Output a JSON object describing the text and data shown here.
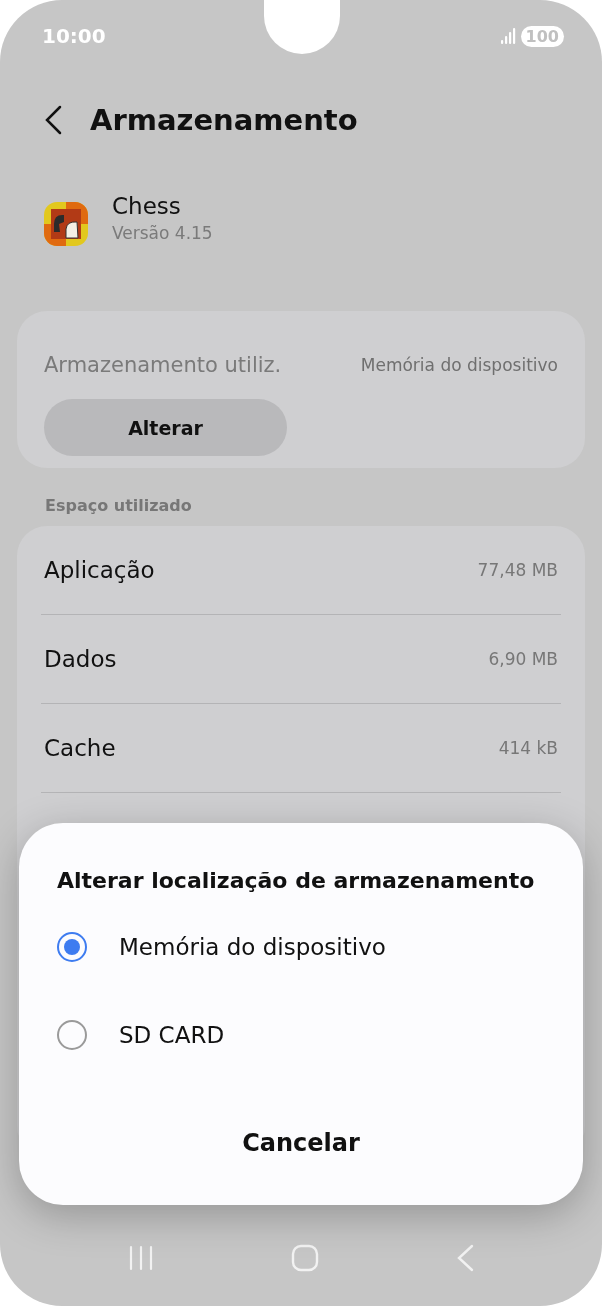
{
  "status_bar": {
    "time": "10:00",
    "battery": "100"
  },
  "header": {
    "title": "Armazenamento"
  },
  "app": {
    "name": "Chess",
    "version": "Versão 4.15"
  },
  "storage_card": {
    "label": "Armazenamento utiliz.",
    "value": "Memória do dispositivo",
    "button": "Alterar"
  },
  "space_section": {
    "heading": "Espaço utilizado",
    "rows": [
      {
        "label": "Aplicação",
        "value": "77,48 MB"
      },
      {
        "label": "Dados",
        "value": "6,90 MB"
      },
      {
        "label": "Cache",
        "value": "414 kB"
      }
    ]
  },
  "dialog": {
    "title": "Alterar localização de armazenamento",
    "options": [
      {
        "label": "Memória do dispositivo",
        "selected": true
      },
      {
        "label": "SD CARD",
        "selected": false
      }
    ],
    "cancel": "Cancelar"
  }
}
